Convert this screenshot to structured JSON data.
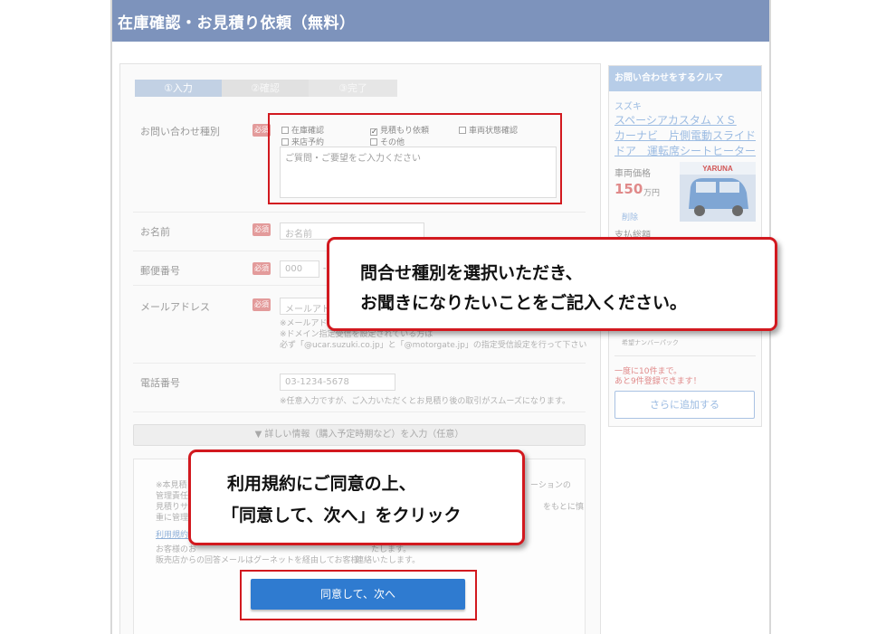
{
  "page_title": "在庫確認・お見積り依頼（無料）",
  "steps": [
    "①入力",
    "②確認",
    "③完了"
  ],
  "form": {
    "inquiry_type": {
      "label": "お問い合わせ種別",
      "required": "必須",
      "options": [
        {
          "label": "在庫確認",
          "checked": false
        },
        {
          "label": "見積もり依頼",
          "checked": true
        },
        {
          "label": "車両状態確認",
          "checked": false
        },
        {
          "label": "来店予約",
          "checked": false
        },
        {
          "label": "その他",
          "checked": false
        }
      ],
      "textarea_placeholder": "ご質問・ご要望をご入力ください"
    },
    "name": {
      "label": "お名前",
      "required": "必須",
      "placeholder": "お名前"
    },
    "postal": {
      "label": "郵便番号",
      "required": "必須",
      "placeholder": "000",
      "sep": "-"
    },
    "email": {
      "label": "メールアドレス",
      "required": "必須",
      "placeholder": "メールアドレス",
      "note1": "※メールアドレス",
      "note2": "※ドメイン指定受信を設定されている方は",
      "note3": "必ず「@ucar.suzuki.co.jp」と「@motorgate.jp」の指定受信設定を行って下さい"
    },
    "phone": {
      "label": "電話番号",
      "placeholder": "03-1234-5678",
      "note": "※任意入力ですが、ご入力いただくとお見積り後の取引がスムーズになります。"
    },
    "more_info": "▼ 詳しい情報（購入予定時期など）を入力（任意）",
    "terms": {
      "line1": "※本見積り",
      "line1_end": "ーションの",
      "line2": "管理責任の",
      "line3": "見積りサー",
      "line3_end": "をもとに慎",
      "line4": "重に管理致",
      "link": "利用規約",
      "line6": "お客様のお",
      "line6_end": "たします。",
      "line7": "販売店からの回答メールはグーネットを経由してお客様",
      "line7_end": "連絡いたします。"
    },
    "submit_label": "同意して、次へ"
  },
  "sidebar": {
    "header": "お問い合わせをするクルマ",
    "maker": "スズキ",
    "car_title_1": "スペーシアカスタム ＸＳ",
    "car_title_2": "カーナビ　片側電動スライド",
    "car_title_3": "ドア　運転席シートヒーター",
    "price_label": "車両価格",
    "price_value": "150",
    "price_unit": "万円",
    "remove_link": "削除",
    "total_label": "支払総額",
    "plate_label": "希望ナンバーパック",
    "limit_note_1": "一度に10件まで。",
    "limit_note_2": "あと9件登録できます！",
    "add_more": "さらに追加する"
  },
  "callouts": {
    "top_line1": "問合せ種別を選択いただき、",
    "top_line2": "お聞きになりたいことをご記入ください。",
    "bottom_line1": "利用規約にご同意の上、",
    "bottom_line2": "「同意して、次へ」をクリック"
  },
  "colors": {
    "title_bar": "#7d93bc",
    "highlight": "#d2191f",
    "submit": "#2f7bd0",
    "required_badge": "#e39b9b",
    "sidebar_header": "#b7cde8"
  }
}
